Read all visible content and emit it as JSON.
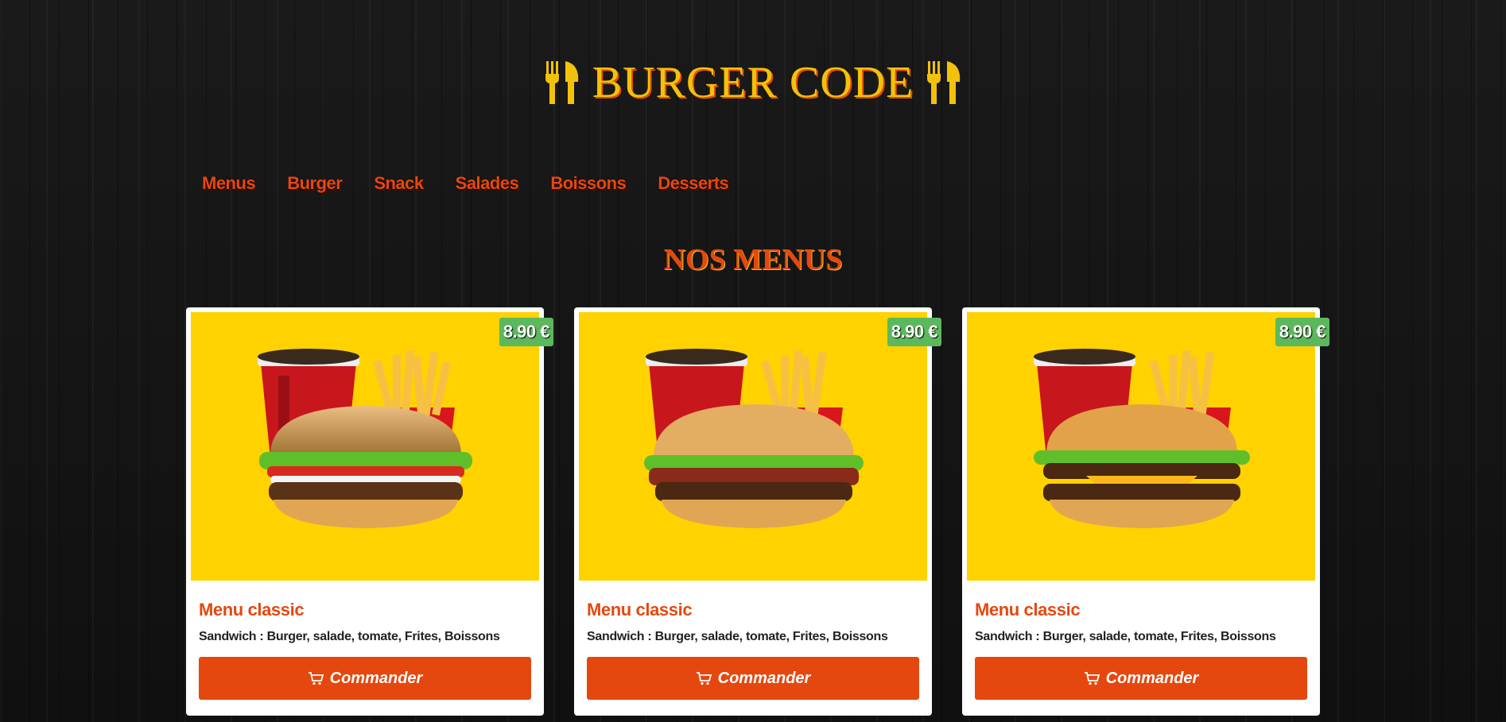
{
  "brand": {
    "title": "BURGER CODE"
  },
  "nav": {
    "items": [
      "Menus",
      "Burger",
      "Snack",
      "Salades",
      "Boissons",
      "Desserts"
    ]
  },
  "section": {
    "title": "NOS MENUS"
  },
  "cards": [
    {
      "price": "8.90 €",
      "title": "Menu classic",
      "description": "Sandwich : Burger, salade, tomate, Frites, Boissons",
      "button": "Commander",
      "variant": "classic"
    },
    {
      "price": "8.90 €",
      "title": "Menu classic",
      "description": "Sandwich : Burger, salade, tomate, Frites, Boissons",
      "button": "Commander",
      "variant": "bacon"
    },
    {
      "price": "8.90 €",
      "title": "Menu classic",
      "description": "Sandwich : Burger, salade, tomate, Frites, Boissons",
      "button": "Commander",
      "variant": "double"
    }
  ],
  "colors": {
    "accent": "#e5480f",
    "gold": "#f2c20a",
    "price_badge": "#5cb85c",
    "image_bg": "#ffd200"
  },
  "icons": {
    "brand_left": "cutlery-icon",
    "brand_right": "cutlery-icon",
    "button": "cart-icon"
  }
}
